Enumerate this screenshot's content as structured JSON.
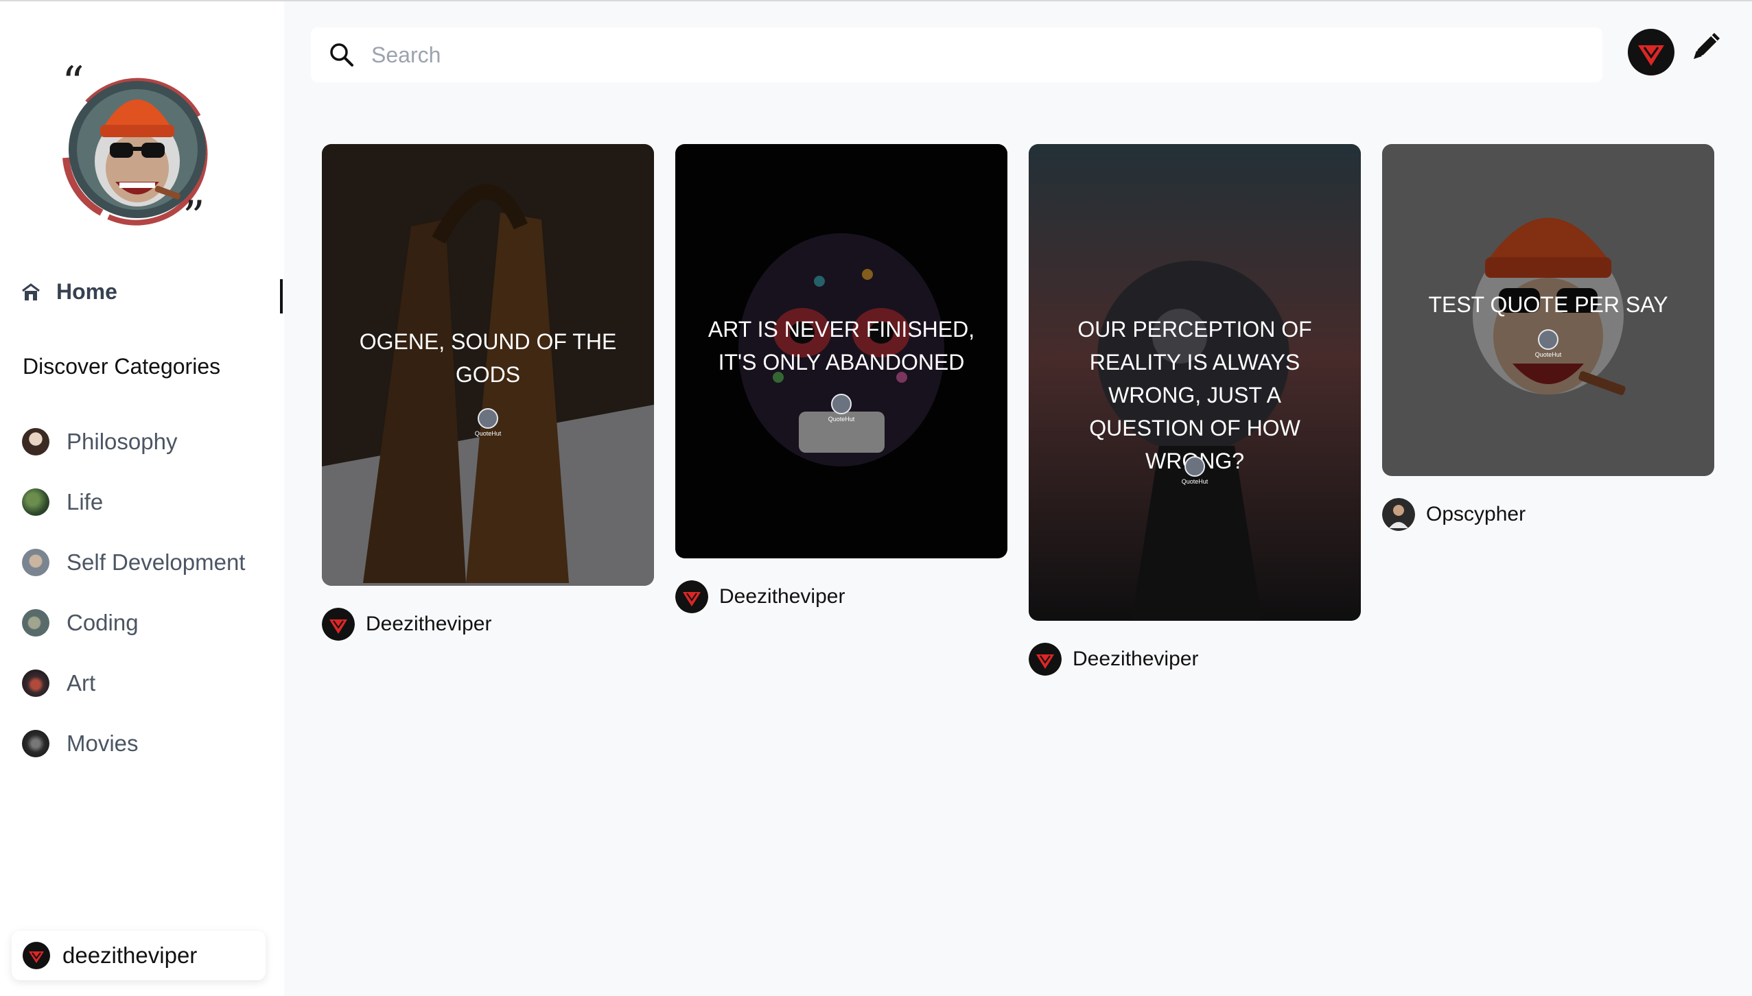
{
  "app": {
    "logo_icon": "quotehut-monkey-logo",
    "accent_color": "#dc2626"
  },
  "sidebar": {
    "home_label": "Home",
    "home_icon": "home-icon",
    "discover_title": "Discover Categories",
    "categories": [
      {
        "label": "Philosophy",
        "avatar_color": "#3b2a22"
      },
      {
        "label": "Life",
        "avatar_color": "#2f4a2c"
      },
      {
        "label": "Self Development",
        "avatar_color": "#7a8590"
      },
      {
        "label": "Coding",
        "avatar_color": "#596a6a"
      },
      {
        "label": "Art",
        "avatar_color": "#3a2a30"
      },
      {
        "label": "Movies",
        "avatar_color": "#2b2b2b"
      }
    ],
    "user": {
      "name": "deezitheviper",
      "avatar_icon": "viper-avatar-icon"
    }
  },
  "header": {
    "search_placeholder": "Search",
    "search_value": "",
    "search_icon": "search-icon",
    "profile_avatar_icon": "viper-avatar-icon",
    "edit_icon": "pencil-icon"
  },
  "feed": [
    {
      "quote": "OGENE, SOUND OF THE GODS",
      "watermark": "QuoteHut",
      "author": "Deezitheviper",
      "author_avatar": "viper-avatar-icon",
      "image": "bronze-bell-photo"
    },
    {
      "quote": "ART IS NEVER FINISHED, IT'S ONLY ABANDONED",
      "watermark": "QuoteHut",
      "author": "Deezitheviper",
      "author_avatar": "viper-avatar-icon",
      "image": "sugar-skull-photo"
    },
    {
      "quote": "OUR PERCEPTION OF REALITY IS ALWAYS WRONG, JUST A QUESTION OF HOW WRONG?",
      "watermark": "QuoteHut",
      "author": "Deezitheviper",
      "author_avatar": "viper-avatar-icon",
      "image": "crystal-ball-photo"
    },
    {
      "quote": "TEST QUOTE PER SAY",
      "watermark": "QuoteHut",
      "author": "Opscypher",
      "author_avatar": "person-avatar-icon",
      "image": "monkey-logo-art"
    }
  ]
}
